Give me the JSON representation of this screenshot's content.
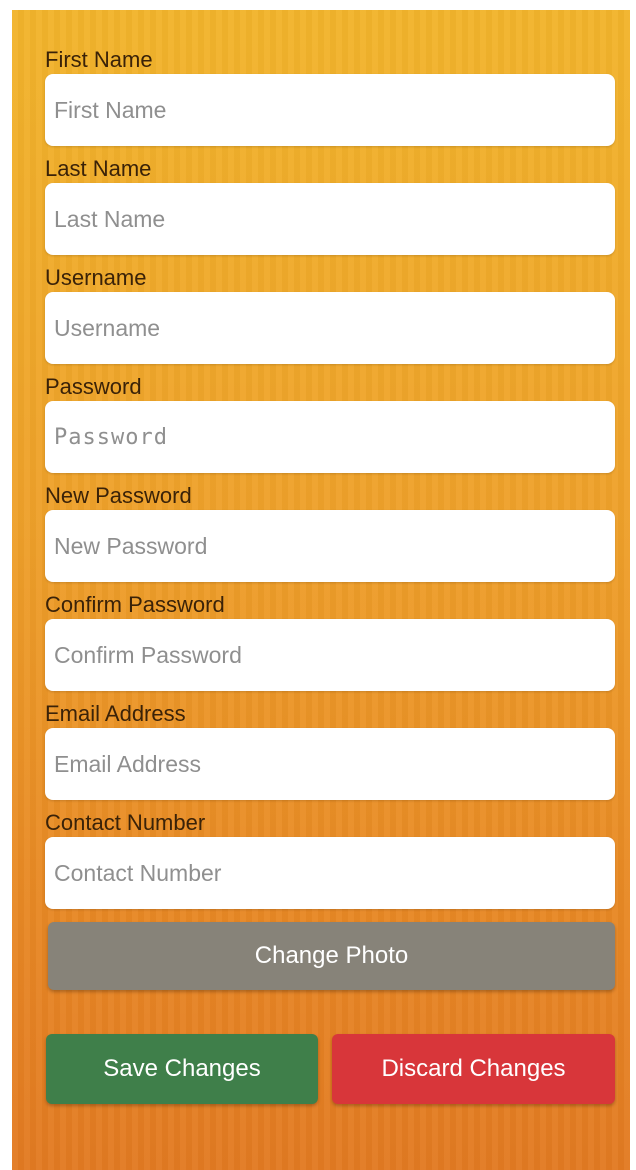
{
  "form": {
    "fields": [
      {
        "label": "First Name",
        "placeholder": "First Name"
      },
      {
        "label": "Last Name",
        "placeholder": "Last Name"
      },
      {
        "label": "Username",
        "placeholder": "Username"
      },
      {
        "label": "Password",
        "placeholder": "Password"
      },
      {
        "label": "New Password",
        "placeholder": "New Password"
      },
      {
        "label": "Confirm Password",
        "placeholder": "Confirm Password"
      },
      {
        "label": "Email Address",
        "placeholder": "Email Address"
      },
      {
        "label": "Contact Number",
        "placeholder": "Contact Number"
      }
    ]
  },
  "buttons": {
    "change_photo": "Change Photo",
    "save": "Save Changes",
    "discard": "Discard Changes"
  },
  "colors": {
    "background_top": "#f2b42c",
    "background_bottom": "#e27a22",
    "label_text": "#3a2208",
    "change_photo_button": "#878379",
    "save_button": "#3f7f4a",
    "discard_button": "#d8363a"
  }
}
